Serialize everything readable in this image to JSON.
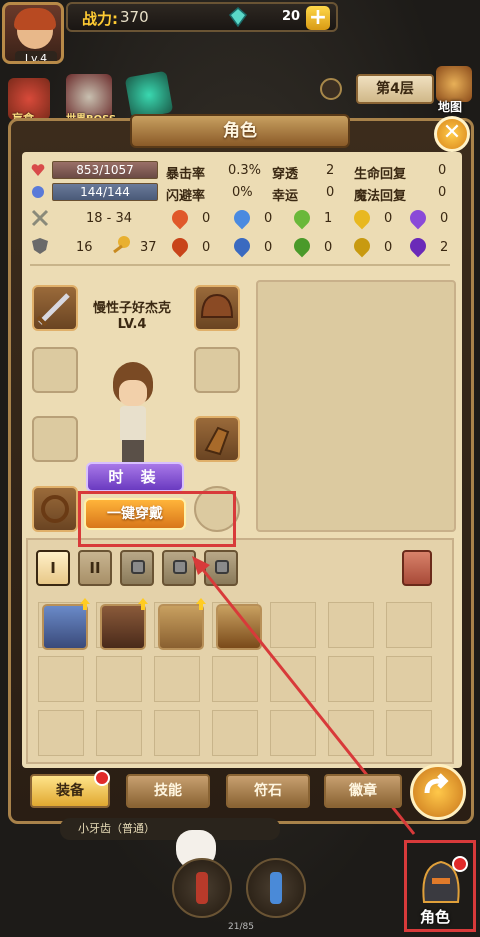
{
  "header": {
    "level": "Lv.4",
    "power_label": "战力:",
    "power_value": "370",
    "gems": "20",
    "plus": "+"
  },
  "top_icons": {
    "icon1_label": "盲盒",
    "icon2_label": "世界BOSS"
  },
  "floor": "第4层",
  "map_label": "地图",
  "panel": {
    "title": "角色",
    "close": "✕"
  },
  "stats": {
    "hp": "853/1057",
    "mp": "144/144",
    "atk": "18 - 34",
    "def": "16",
    "speed": "37",
    "crit_label": "暴击率",
    "crit": "0.3%",
    "pierce_label": "穿透",
    "pierce": "2",
    "hp_regen_label": "生命回复",
    "hp_regen": "0",
    "dodge_label": "闪避率",
    "dodge": "0%",
    "luck_label": "幸运",
    "luck": "0",
    "mp_regen_label": "魔法回复",
    "mp_regen": "0",
    "elem_row1": [
      "0",
      "0",
      "1",
      "0",
      "0"
    ],
    "elem_row2": [
      "0",
      "0",
      "0",
      "0",
      "2"
    ],
    "elem_row1_extra": "0",
    "elem_row2_extra": "0"
  },
  "character": {
    "name": "慢性子好杰克",
    "level": "LV.4"
  },
  "buttons": {
    "fashion": "时 装",
    "equip_all": "一键穿戴"
  },
  "bag_pages": [
    "I",
    "II"
  ],
  "bottom_tabs": [
    "装备",
    "技能",
    "符石",
    "徽章"
  ],
  "chat_text": "小牙齿（普通）",
  "counter": "21/85",
  "char_button_label": "角色",
  "colors": {
    "highlight_red": "#d83a3a",
    "panel_bg": "#ecdcb4",
    "accent_gold": "#ffcc33"
  }
}
